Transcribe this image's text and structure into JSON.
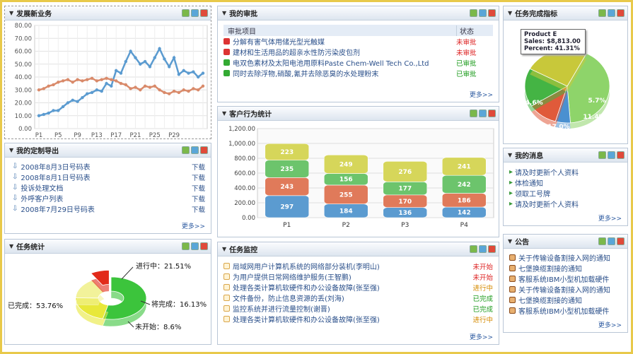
{
  "colors": {
    "accent": "#2a4f8a",
    "red": "#dd2222",
    "green": "#1a9a1a",
    "orange": "#d58a00",
    "frame": "#e8c94a"
  },
  "panels": {
    "business": {
      "title": "发展新业务"
    },
    "export": {
      "title": "我的定制导出",
      "items": [
        {
          "label": "2008年8月3日号码表",
          "action": "下载"
        },
        {
          "label": "2008年8月1日号码表",
          "action": "下载"
        },
        {
          "label": "投诉处理文档",
          "action": "下载"
        },
        {
          "label": "外呼客户列表",
          "action": "下载"
        },
        {
          "label": "2008年7月29日号码表",
          "action": "下载"
        }
      ],
      "more": "更多>>"
    },
    "tasks": {
      "title": "任务统计"
    },
    "approval": {
      "title": "我的审批",
      "col_item": "审批项目",
      "col_status": "状态",
      "items": [
        {
          "label": "分解有害气体用储光型光触媒",
          "status": "未审批",
          "icon": "red"
        },
        {
          "label": "建材和生活用品的超亲水性防污染皮包剂",
          "status": "未审批",
          "icon": "red"
        },
        {
          "label": "电双色素材及太阳电池用原料Paste Chem-Well Tech Co.,Ltd",
          "status": "已审批",
          "icon": "green"
        },
        {
          "label": "同时去除浮物,硝酸,氰并去除恶臭的水处理粉末",
          "status": "已审批",
          "icon": "green"
        }
      ],
      "more": "更多>>"
    },
    "behavior": {
      "title": "客户行为统计"
    },
    "monitor": {
      "title": "任务监控",
      "items": [
        {
          "label": "局域网用户计算机系统的网络部分装机(李明山)",
          "status": "未开始",
          "cls": "red"
        },
        {
          "label": "为用户提供日常网络维护服务(王智鹏)",
          "status": "未开始",
          "cls": "red"
        },
        {
          "label": "处理各类计算机软硬件和办公设备故障(张至强)",
          "status": "进行中",
          "cls": "org"
        },
        {
          "label": "文件备份，防止信息资源的丢(刘海)",
          "status": "已完成",
          "cls": "grn"
        },
        {
          "label": "监控系统并进行流量控制(谢晋)",
          "status": "已完成",
          "cls": "grn"
        },
        {
          "label": "处理各类计算机软硬件和办公设备故障(张至强)",
          "status": "进行中",
          "cls": "org"
        }
      ],
      "more": "更多>>"
    },
    "completion": {
      "title": "任务完成指标",
      "tooltip": {
        "name": "Product E",
        "sales": "Sales: $8,813.00",
        "percent": "Percent: 41.31%"
      }
    },
    "messages": {
      "title": "我的消息",
      "items": [
        "请及时更新个人资料",
        "体检通知",
        "领取工号牌",
        "请及时更新个人资料"
      ],
      "more": "更多>>"
    },
    "notice": {
      "title": "公告",
      "items": [
        "关于传输设备割接入网的通知",
        "七堡换缆割接的通知",
        "客服系统IBM小型机加载硬件",
        "关于传输设备割接入网的通知",
        "七堡换缆割接的通知",
        "客服系统IBM小型机加载硬件"
      ],
      "more": "更多>>"
    }
  },
  "chart_data": [
    {
      "type": "line",
      "x": [
        "P1",
        "P5",
        "P9",
        "P13",
        "P17",
        "P21",
        "P25",
        "P29"
      ],
      "ylim": [
        0,
        80
      ],
      "yticks": [
        "0.00",
        "10.00",
        "20.00",
        "30.00",
        "40.00",
        "50.00",
        "60.00",
        "70.00",
        "80.00"
      ],
      "series": [
        {
          "values": [
            10,
            11,
            12,
            14,
            14,
            17,
            20,
            22,
            21,
            24,
            27,
            28,
            30,
            29,
            35,
            33,
            45,
            43,
            52,
            60,
            55,
            50,
            52,
            48,
            55,
            62,
            54,
            48,
            55,
            42,
            45,
            43,
            44,
            40,
            43
          ],
          "color": "#5b9bd0"
        },
        {
          "values": [
            30,
            31,
            33,
            34,
            36,
            37,
            38,
            36,
            38,
            37,
            38,
            39,
            37,
            38,
            39,
            38,
            37,
            35,
            34,
            31,
            32,
            30,
            33,
            32,
            33,
            30,
            28,
            27,
            29,
            28,
            30,
            29,
            31,
            30,
            33
          ],
          "color": "#d98a6a"
        }
      ]
    },
    {
      "type": "pie",
      "slices": [
        {
          "label": "已完成",
          "pct": "53.76%",
          "value": 53.76,
          "color": "#3cc43c"
        },
        {
          "label": "进行中",
          "pct": "21.51%",
          "value": 21.51,
          "color": "#e8e83a"
        },
        {
          "label": "将完成",
          "pct": "16.13%",
          "value": 16.13,
          "color": "#f2f29a"
        },
        {
          "label": "未开始",
          "pct": "8.6%",
          "value": 8.6,
          "color": "#e22a1a"
        }
      ]
    },
    {
      "type": "bar",
      "categories": [
        "P1",
        "P2",
        "P3",
        "P4"
      ],
      "ylim": [
        0,
        1200
      ],
      "yticks": [
        "0.00",
        "200.00",
        "400.00",
        "600.00",
        "800.00",
        "1,000.00",
        "1,200.00"
      ],
      "series": [
        {
          "values": [
            297,
            184,
            136,
            142
          ],
          "color": "#5b9bd0"
        },
        {
          "values": [
            243,
            255,
            170,
            186
          ],
          "color": "#e07a5a"
        },
        {
          "values": [
            235,
            156,
            177,
            242
          ],
          "color": "#6cc46c"
        },
        {
          "values": [
            223,
            249,
            276,
            241
          ],
          "color": "#d6d65a"
        }
      ]
    },
    {
      "type": "pie",
      "slices": [
        {
          "label": "41.3%",
          "value": 41.3,
          "color": "#8ed46a"
        },
        {
          "label": "5.7%",
          "value": 5.7,
          "color": "#4a90d0"
        },
        {
          "label": "11.4%",
          "value": 11.4,
          "color": "#e05a3a"
        },
        {
          "label": "17.0%",
          "value": 17.0,
          "color": "#44b444"
        },
        {
          "label": "24.6%",
          "value": 24.6,
          "color": "#c8c83a"
        }
      ]
    }
  ]
}
